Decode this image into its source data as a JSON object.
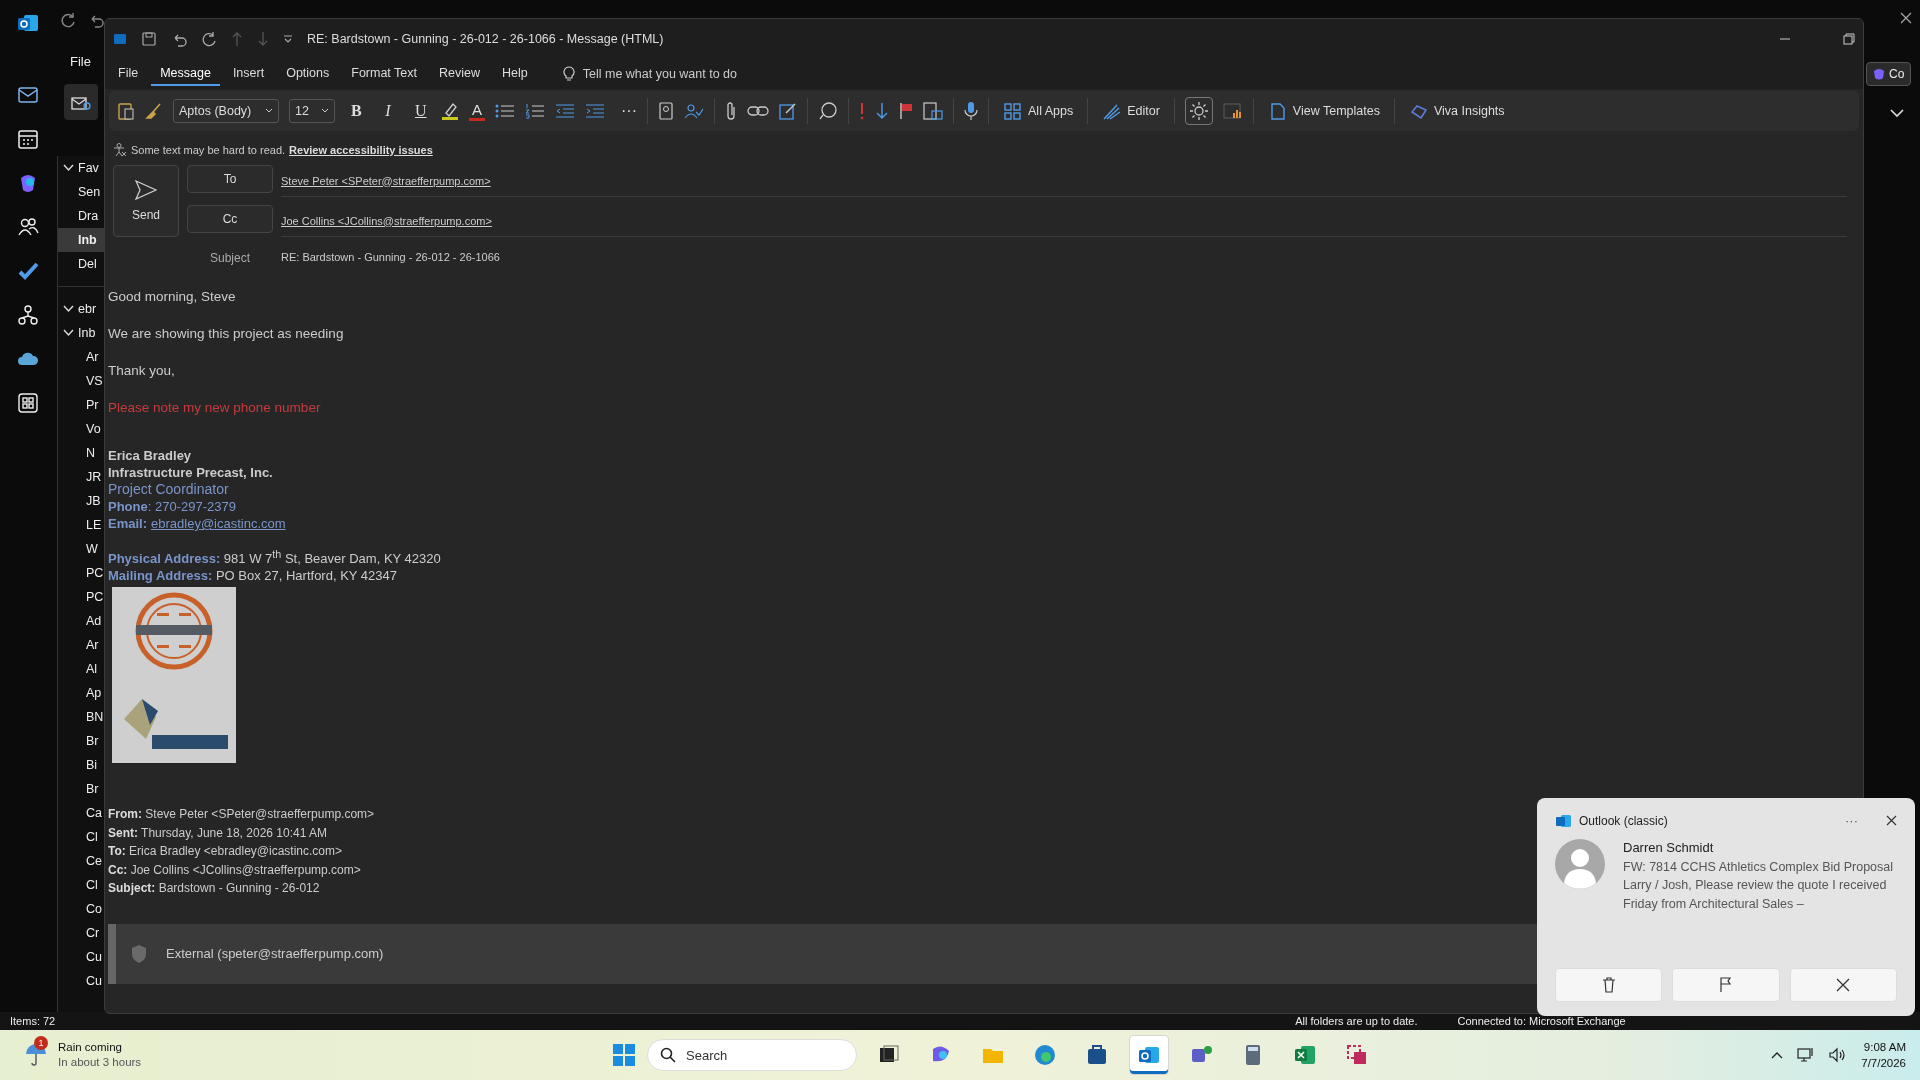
{
  "main_window": {
    "file_tab": "File",
    "copilot_button": "Co",
    "folder_pane": {
      "favorites": {
        "label": "Fav",
        "expanded": true,
        "children": [
          {
            "label": "Sen",
            "selected": false
          },
          {
            "label": "Dra",
            "selected": false
          },
          {
            "label": "Inb",
            "selected": true
          },
          {
            "label": "Del",
            "selected": false
          }
        ]
      },
      "account": {
        "label": "ebr",
        "expanded": true,
        "children": [
          {
            "label": "Inb",
            "expanded": true,
            "children": [
              {
                "label": "Ar"
              },
              {
                "label": "VS"
              },
              {
                "label": "Pr"
              },
              {
                "label": "Vo"
              },
              {
                "label": "N"
              },
              {
                "label": "JR"
              },
              {
                "label": "JB"
              },
              {
                "label": "LE"
              },
              {
                "label": "W"
              },
              {
                "label": "PC"
              },
              {
                "label": "PC"
              },
              {
                "label": "Ad"
              },
              {
                "label": "Ar"
              },
              {
                "label": "Al"
              },
              {
                "label": "Ap"
              },
              {
                "label": "BN"
              },
              {
                "label": "Br"
              },
              {
                "label": "Bi"
              },
              {
                "label": "Br"
              },
              {
                "label": "Ca"
              },
              {
                "label": "Cl"
              },
              {
                "label": "Ce"
              },
              {
                "label": "Cl"
              },
              {
                "label": "Co"
              },
              {
                "label": "Cr"
              },
              {
                "label": "Cu"
              },
              {
                "label": "Cu"
              }
            ]
          }
        ]
      }
    },
    "status_bar": {
      "items": "Items: 72",
      "sync": "All folders are up to date.",
      "connection": "Connected to: Microsoft Exchange"
    }
  },
  "message_window": {
    "title": "RE: Bardstown - Gunning - 26-012 - 26-1066  -  Message (HTML)",
    "tabs": [
      {
        "label": "File",
        "selected": false
      },
      {
        "label": "Message",
        "selected": true
      },
      {
        "label": "Insert",
        "selected": false
      },
      {
        "label": "Options",
        "selected": false
      },
      {
        "label": "Format Text",
        "selected": false
      },
      {
        "label": "Review",
        "selected": false
      },
      {
        "label": "Help",
        "selected": false
      }
    ],
    "tell_me": "Tell me what you want to do",
    "ribbon": {
      "font": "Aptos (Body)",
      "size": "12",
      "bold": "B",
      "italic": "I",
      "underline": "U",
      "font_color": "A",
      "more": "···",
      "buttons": [
        {
          "label": "All Apps",
          "kind": "apps"
        },
        {
          "label": "Editor",
          "kind": "editor"
        },
        {
          "label": "View Templates",
          "kind": "templates"
        },
        {
          "label": "Viva Insights",
          "kind": "insights"
        }
      ]
    },
    "accessibility": {
      "message": "Some text may be hard to read.",
      "link": "Review accessibility issues"
    },
    "send_button": "Send",
    "to_button": "To",
    "to": "Steve Peter <SPeter@straefferpump.com>",
    "cc_button": "Cc",
    "cc": "Joe Collins <JCollins@straefferpump.com>",
    "subject_label": "Subject",
    "subject": "RE: Bardstown - Gunning - 26-012 - 26-1066",
    "body": {
      "greeting": "Good morning, Steve",
      "line": "We are showing this project as needing",
      "thanks": "Thank you,",
      "note": "Please note my new phone number",
      "signature": {
        "name": "Erica Bradley",
        "company": "Infrastructure Precast, Inc.",
        "title": "Project Coordinator",
        "lines": [
          {
            "label": "Phone",
            "value": ": 270-297-2379",
            "kind": "text"
          },
          {
            "label": "Email:",
            "value": "ebradley@icastinc.com",
            "kind": "link"
          },
          {
            "label": "Physical Address:",
            "value": " 981 W 7$^{th}$ St, Beaver Dam, KY 42320",
            "kind": "text"
          },
          {
            "label": "Mailing Address:",
            "value": " PO Box 27, Hartford, KY 42347",
            "kind": "text"
          }
        ]
      },
      "quoted_header": [
        "**From:** Steve Peter <SPeter@straefferpump.com>",
        "**Sent:** Thursday, June 18, 2026 10:41 AM",
        "**To:** Erica Bradley <ebradley@icastinc.com>",
        "**Cc:** Joe Collins <JCollins@straefferpump.com>",
        "**Subject:** Bardstown - Gunning - 26-012"
      ],
      "external_banner": "External (speter@straefferpump.com)"
    }
  },
  "notification": {
    "app": "Outlook (classic)",
    "more": "···",
    "sender": "Darren Schmidt",
    "subject": "FW: 7814 CCHS Athletics Complex Bid Proposal",
    "preview": "Larry / Josh, Please review the quote I received Friday from Architectural Sales –"
  },
  "taskbar": {
    "weather": {
      "badge": "1",
      "title": "Rain coming",
      "subtitle": "In about 3 hours"
    },
    "search": "Search",
    "apps": [
      {
        "kind": "taskview",
        "selected": false
      },
      {
        "kind": "m365",
        "selected": false
      },
      {
        "kind": "explorer",
        "selected": false
      },
      {
        "kind": "edge",
        "selected": false
      },
      {
        "kind": "store",
        "selected": false
      },
      {
        "kind": "outlook",
        "selected": true
      },
      {
        "kind": "teams",
        "selected": false
      },
      {
        "kind": "calculator",
        "selected": false
      },
      {
        "kind": "excel",
        "selected": false
      },
      {
        "kind": "snip",
        "selected": false
      }
    ],
    "time": "9:08 AM",
    "date": "7/7/2026"
  }
}
